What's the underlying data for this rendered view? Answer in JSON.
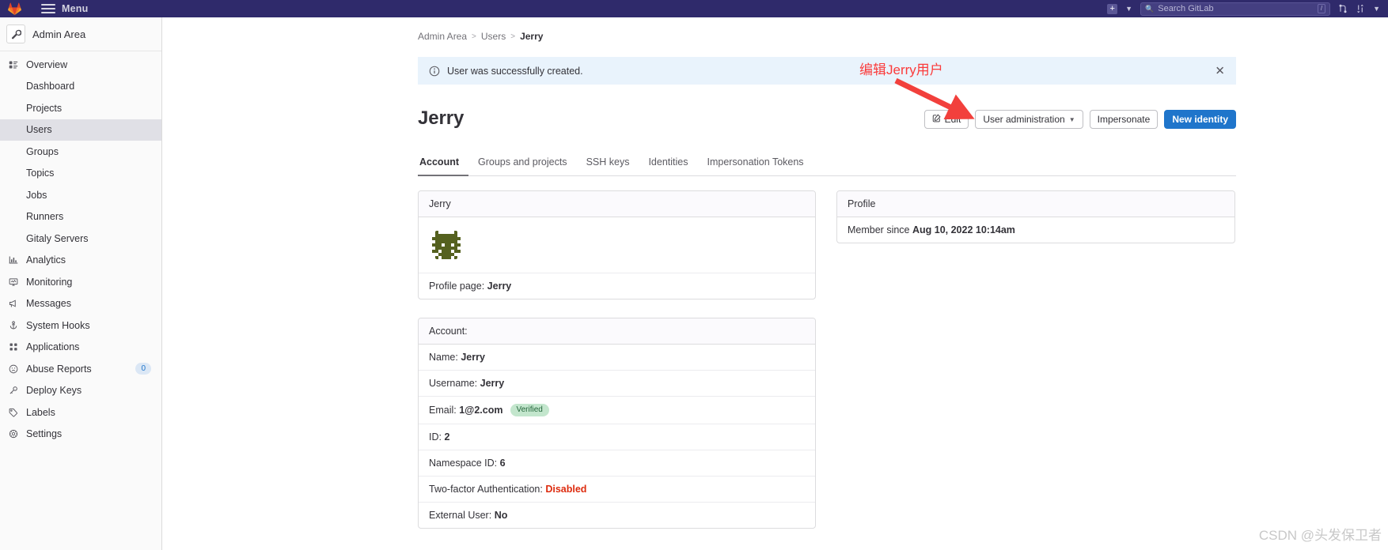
{
  "topbar": {
    "menu_label": "Menu",
    "logo_icon": "gitlab-logo-icon",
    "hamburger_icon": "hamburger-menu-icon",
    "plus_icon": "plus-square-icon",
    "chevron_icon": "chevron-down-icon",
    "search_placeholder": "Search GitLab",
    "search_icon": "search-icon",
    "search_shortcut": "/",
    "merge_requests_icon": "merge-request-icon",
    "issues_icon": "issues-icon",
    "user_chevron_icon": "chevron-down-icon",
    "brand_color": "#2f2a6b"
  },
  "sidebar": {
    "context_title": "Admin Area",
    "context_icon": "wrench-icon",
    "items": [
      {
        "label": "Overview",
        "icon": "overview-icon",
        "type": "top"
      },
      {
        "label": "Dashboard",
        "type": "sub",
        "active": false
      },
      {
        "label": "Projects",
        "type": "sub",
        "active": false
      },
      {
        "label": "Users",
        "type": "sub",
        "active": true
      },
      {
        "label": "Groups",
        "type": "sub",
        "active": false
      },
      {
        "label": "Topics",
        "type": "sub",
        "active": false
      },
      {
        "label": "Jobs",
        "type": "sub",
        "active": false
      },
      {
        "label": "Runners",
        "type": "sub",
        "active": false
      },
      {
        "label": "Gitaly Servers",
        "type": "sub",
        "active": false
      },
      {
        "label": "Analytics",
        "icon": "chart-bar-icon",
        "type": "top"
      },
      {
        "label": "Monitoring",
        "icon": "monitor-icon",
        "type": "top"
      },
      {
        "label": "Messages",
        "icon": "megaphone-icon",
        "type": "top"
      },
      {
        "label": "System Hooks",
        "icon": "hook-anchor-icon",
        "type": "top"
      },
      {
        "label": "Applications",
        "icon": "applications-grid-icon",
        "type": "top"
      },
      {
        "label": "Abuse Reports",
        "icon": "sad-face-icon",
        "type": "top",
        "badge": "0"
      },
      {
        "label": "Deploy Keys",
        "icon": "key-icon",
        "type": "top"
      },
      {
        "label": "Labels",
        "icon": "label-tag-icon",
        "type": "top"
      },
      {
        "label": "Settings",
        "icon": "gear-icon",
        "type": "top"
      }
    ]
  },
  "breadcrumb": {
    "items": [
      "Admin Area",
      "Users",
      "Jerry"
    ],
    "separator": ">"
  },
  "alert": {
    "message": "User was successfully created.",
    "info_icon": "info-circle-icon",
    "close_icon": "close-x-icon",
    "background": "#e9f3fc"
  },
  "page": {
    "title": "Jerry"
  },
  "actions": {
    "edit_label": "Edit",
    "edit_icon": "pencil-square-icon",
    "user_administration_label": "User administration",
    "user_administration_chevron": "chevron-down-icon",
    "impersonate_label": "Impersonate",
    "new_identity_label": "New identity",
    "primary_color": "#1f75cb"
  },
  "tabs": [
    {
      "label": "Account",
      "active": true
    },
    {
      "label": "Groups and projects",
      "active": false
    },
    {
      "label": "SSH keys",
      "active": false
    },
    {
      "label": "Identities",
      "active": false
    },
    {
      "label": "Impersonation Tokens",
      "active": false
    }
  ],
  "user_card": {
    "header": "Jerry",
    "avatar_icon": "identicon-avatar",
    "avatar_color": "#55611f",
    "profile_page_label": "Profile page:",
    "profile_page_value": "Jerry"
  },
  "account_card": {
    "header": "Account:",
    "rows": [
      {
        "label": "Name:",
        "value": "Jerry"
      },
      {
        "label": "Username:",
        "value": "Jerry"
      },
      {
        "label": "Email:",
        "value": "1@2.com",
        "badge": "Verified"
      },
      {
        "label": "ID:",
        "value": "2"
      },
      {
        "label": "Namespace ID:",
        "value": "6"
      },
      {
        "label": "Two-factor Authentication:",
        "value": "Disabled",
        "danger": true
      },
      {
        "label": "External User:",
        "value": "No"
      }
    ]
  },
  "profile_card": {
    "header": "Profile",
    "member_since_label": "Member since",
    "member_since_value": "Aug 10, 2022 10:14am"
  },
  "annotation": {
    "text": "编辑Jerry用户",
    "color": "#fb3b3b",
    "arrow_icon": "red-arrow-icon"
  },
  "watermark": {
    "text": "CSDN @头发保卫者"
  }
}
